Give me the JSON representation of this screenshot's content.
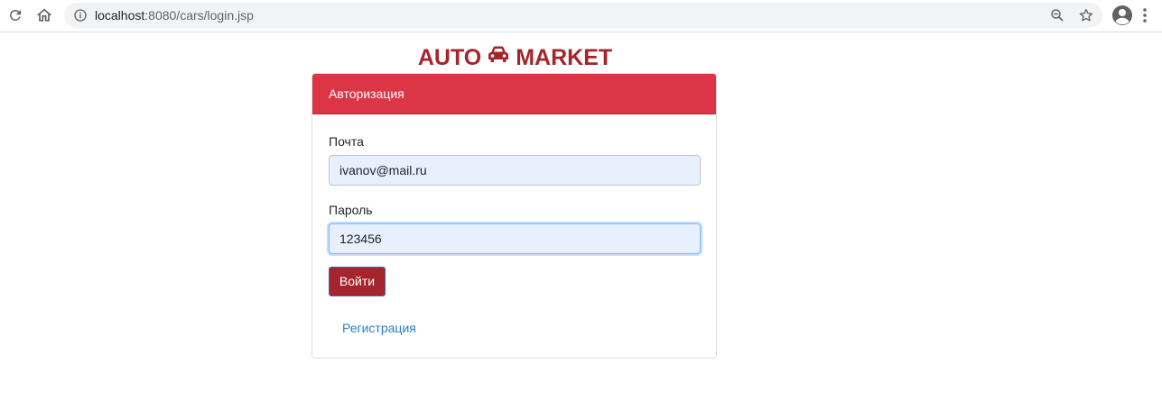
{
  "browser": {
    "url_host": "localhost",
    "url_rest": ":8080/cars/login.jsp",
    "icons": {
      "reload": "reload-icon",
      "home": "home-icon",
      "info": "info-icon",
      "zoom": "zoom-icon",
      "bookmark": "star-icon",
      "profile": "account-icon",
      "menu": "more-vert-icon"
    }
  },
  "page": {
    "brand_left": "AUTO",
    "brand_right": "MARKET",
    "brand_icon": "car-icon",
    "brand_color": "#a4262c"
  },
  "login_card": {
    "header": "Авторизация",
    "header_color": "#dc3545",
    "email_label": "Почта",
    "email_value": "ivanov@mail.ru",
    "password_label": "Пароль",
    "password_value": "123456",
    "submit_label": "Войти",
    "register_link": "Регистрация"
  }
}
